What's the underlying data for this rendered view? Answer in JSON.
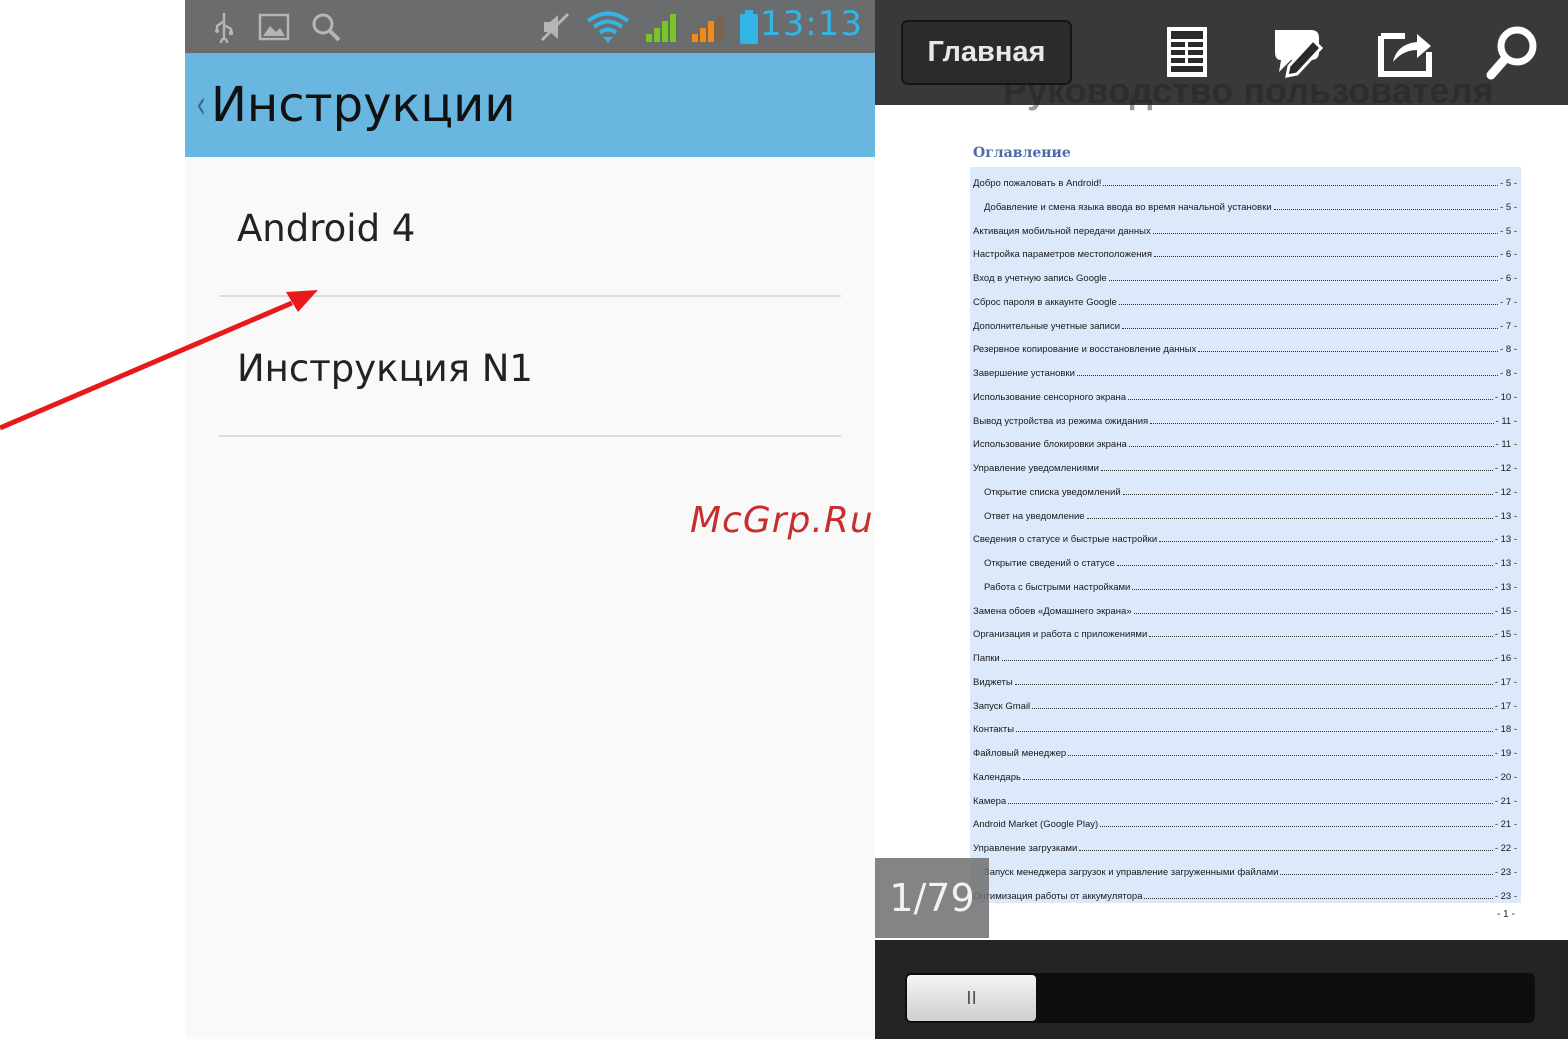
{
  "left_screen": {
    "status_bar": {
      "time": "13:13",
      "icons": [
        "usb-icon",
        "image-icon",
        "search-icon",
        "mute-icon",
        "wifi-icon",
        "signal-icon",
        "signal-icon",
        "battery-icon"
      ],
      "time_color": "#33b5e5"
    },
    "action_bar": {
      "title": "Инструкции",
      "color": "#69b6e0"
    },
    "list": [
      {
        "label": "Android 4"
      },
      {
        "label": "Инструкция N1"
      }
    ]
  },
  "right_screen": {
    "toolbar": {
      "home_label": "Главная",
      "icons": [
        "table-of-contents-icon",
        "annotate-icon",
        "share-icon",
        "search-icon"
      ]
    },
    "document": {
      "title": "Руководство пользователя",
      "toc_heading": "Оглавление",
      "toc": [
        {
          "text": "Добро пожаловать в Android!",
          "page": "- 5 -",
          "indent": false
        },
        {
          "text": "Добавление и смена языка ввода во время начальной установки",
          "page": "- 5 -",
          "indent": true
        },
        {
          "text": "Активация мобильной передачи данных",
          "page": "- 5 -",
          "indent": false
        },
        {
          "text": "Настройка параметров местоположения",
          "page": "- 6 -",
          "indent": false
        },
        {
          "text": "Вход в учетную запись Google",
          "page": "- 6 -",
          "indent": false
        },
        {
          "text": "Сброс пароля в аккаунте Google",
          "page": "- 7 -",
          "indent": false
        },
        {
          "text": "Дополнительные учетные записи",
          "page": "- 7 -",
          "indent": false
        },
        {
          "text": "Резервное копирование и восстановление данных",
          "page": "- 8 -",
          "indent": false
        },
        {
          "text": "Завершение установки",
          "page": "- 8 -",
          "indent": false
        },
        {
          "text": "Использование сенсорного экрана",
          "page": "- 10 -",
          "indent": false
        },
        {
          "text": "Вывод устройства из режима ожидания",
          "page": "- 11 -",
          "indent": false
        },
        {
          "text": "Использование блокировки экрана",
          "page": "- 11 -",
          "indent": false
        },
        {
          "text": "Управление уведомлениями",
          "page": "- 12 -",
          "indent": false
        },
        {
          "text": "Открытие списка уведомлений",
          "page": "- 12 -",
          "indent": true
        },
        {
          "text": "Ответ на уведомление",
          "page": "- 13 -",
          "indent": true
        },
        {
          "text": "Сведения о статусе и быстрые настройки",
          "page": "- 13 -",
          "indent": false
        },
        {
          "text": "Открытие сведений о статусе",
          "page": "- 13 -",
          "indent": true
        },
        {
          "text": "Работа с быстрыми настройками",
          "page": "- 13 -",
          "indent": true
        },
        {
          "text": "Замена обоев «Домашнего экрана»",
          "page": "- 15 -",
          "indent": false
        },
        {
          "text": "Организация и работа с приложениями",
          "page": "- 15 -",
          "indent": false
        },
        {
          "text": "Папки",
          "page": "- 16 -",
          "indent": false
        },
        {
          "text": "Виджеты",
          "page": "- 17 -",
          "indent": false
        },
        {
          "text": "Запуск Gmail",
          "page": "- 17 -",
          "indent": false
        },
        {
          "text": "Контакты",
          "page": "- 18 -",
          "indent": false
        },
        {
          "text": "Файловый менеджер",
          "page": "- 19 -",
          "indent": false
        },
        {
          "text": "Календарь",
          "page": "- 20 -",
          "indent": false
        },
        {
          "text": "Камера",
          "page": "- 21 -",
          "indent": false
        },
        {
          "text": "Android Market (Google Play)",
          "page": "- 21 -",
          "indent": false
        },
        {
          "text": "Управление загрузками",
          "page": "- 22 -",
          "indent": false
        },
        {
          "text": "Запуск менеджера загрузок и управление загруженными файлами",
          "page": "- 23 -",
          "indent": true
        },
        {
          "text": "Оптимизация работы от аккумулятора",
          "page": "- 23 -",
          "indent": false
        }
      ],
      "footer_page": "- 1 -"
    },
    "page_counter": "1/79",
    "seek": {
      "thumb_glyph": "II",
      "progress_fraction": 0.0
    }
  },
  "watermark": "McGrp.Ru",
  "annotation_arrow_color": "#e8191c"
}
